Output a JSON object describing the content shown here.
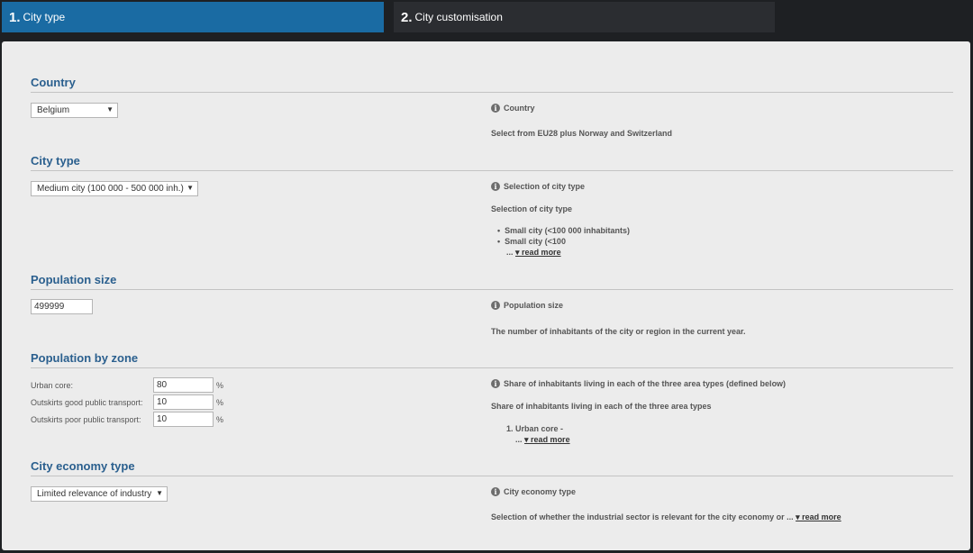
{
  "tabs": [
    {
      "num": "1.",
      "label": "City type"
    },
    {
      "num": "2.",
      "label": "City customisation"
    }
  ],
  "country": {
    "title": "Country",
    "value": "Belgium",
    "info_title": "Country",
    "info_text": "Select from EU28 plus Norway and Switzerland"
  },
  "city_type": {
    "title": "City type",
    "value": "Medium city (100 000 - 500 000 inh.)",
    "info_title": "Selection of city type",
    "info_heading": "Selection of city type",
    "bullets": [
      "Small city (<100 000 inhabitants)",
      "Small city (<100"
    ],
    "ellipsis": "...",
    "read_more": "▾ read more"
  },
  "population_size": {
    "title": "Population size",
    "value": "499999",
    "info_title": "Population size",
    "info_text": "The number of inhabitants of the city or region in the current year."
  },
  "population_zone": {
    "title": "Population by zone",
    "fields": [
      {
        "label": "Urban core:",
        "value": "80",
        "unit": "%"
      },
      {
        "label": "Outskirts good public transport:",
        "value": "10",
        "unit": "%"
      },
      {
        "label": "Outskirts poor public transport:",
        "value": "10",
        "unit": "%"
      }
    ],
    "info_title": "Share of inhabitants living in each of the three area types (defined below)",
    "info_heading": "Share of inhabitants living in each of the three area types",
    "list_item": "1. Urban core -",
    "ellipsis": "...",
    "read_more": "▾ read more"
  },
  "economy_type": {
    "title": "City economy type",
    "value": "Limited relevance of industry",
    "info_title": "City economy type",
    "info_text": "Selection of whether the industrial sector is relevant for the city economy or ...",
    "read_more": "▾ read more"
  },
  "icons": {
    "dropdown": "▼",
    "info": "i"
  }
}
